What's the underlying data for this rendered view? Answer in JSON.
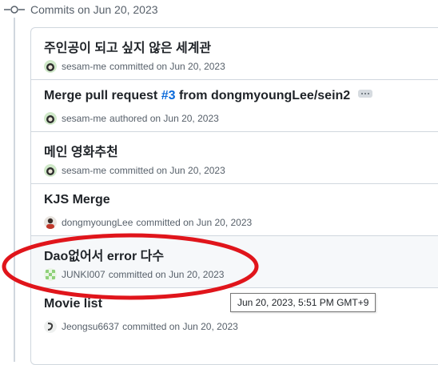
{
  "group": {
    "title": "Commits on Jun 20, 2023"
  },
  "commits": [
    {
      "title": "주인공이 되고 싶지 않은 세계관",
      "author": "sesam-me",
      "action": "committed on Jun 20, 2023"
    },
    {
      "title_prefix": "Merge pull request ",
      "pr_link": "#3",
      "title_suffix": " from dongmyoungLee/sein2",
      "author": "sesam-me",
      "action": "authored on Jun 20, 2023"
    },
    {
      "title": "메인 영화추천",
      "author": "sesam-me",
      "action": "committed on Jun 20, 2023"
    },
    {
      "title": "KJS Merge",
      "author": "dongmyoungLee",
      "action": "committed on Jun 20, 2023"
    },
    {
      "title": "Dao없어서 error 다수",
      "author": "JUNKI007",
      "action": "committed on Jun 20, 2023"
    },
    {
      "title": "Movie list",
      "author": "Jeongsu6637",
      "action": "committed on Jun 20, 2023"
    }
  ],
  "tooltip": {
    "text": "Jun 20, 2023, 5:51 PM GMT+9"
  },
  "colors": {
    "link": "#0969da",
    "annotation_circle": "#e0151b",
    "border": "#d0d7de",
    "muted_text": "#57606a"
  },
  "icons": {
    "group_marker": "git-commit-icon",
    "more": "ellipsis-icon"
  }
}
